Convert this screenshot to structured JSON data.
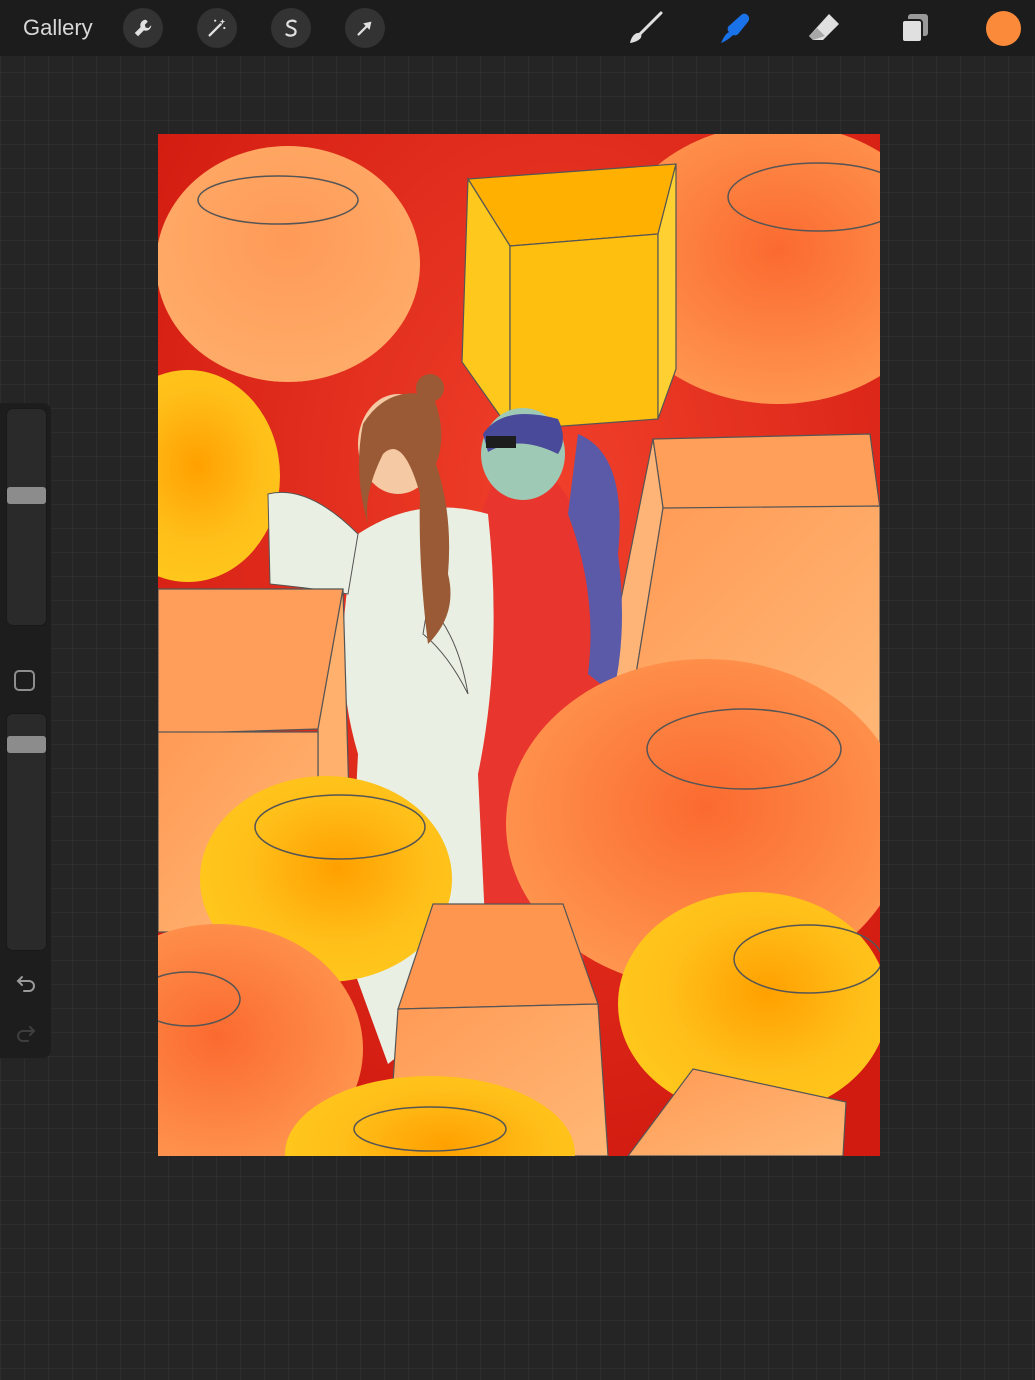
{
  "topbar": {
    "gallery_label": "Gallery",
    "left_tools": [
      "wrench-icon",
      "magic-wand-icon",
      "selection-s-icon",
      "transform-arrow-icon"
    ],
    "right_tools": [
      "brush-icon",
      "smudge-icon",
      "eraser-icon",
      "layers-icon"
    ],
    "active_tool": "smudge",
    "active_color": "#fb8a3b",
    "accent_color": "#1a72e8"
  },
  "sidebar": {
    "brush_size_level": 0.41,
    "opacity_level": 0.9,
    "undo_icon": "undo-icon",
    "redo_icon": "redo-icon"
  },
  "canvas": {
    "artwork_subject": "illustration"
  }
}
